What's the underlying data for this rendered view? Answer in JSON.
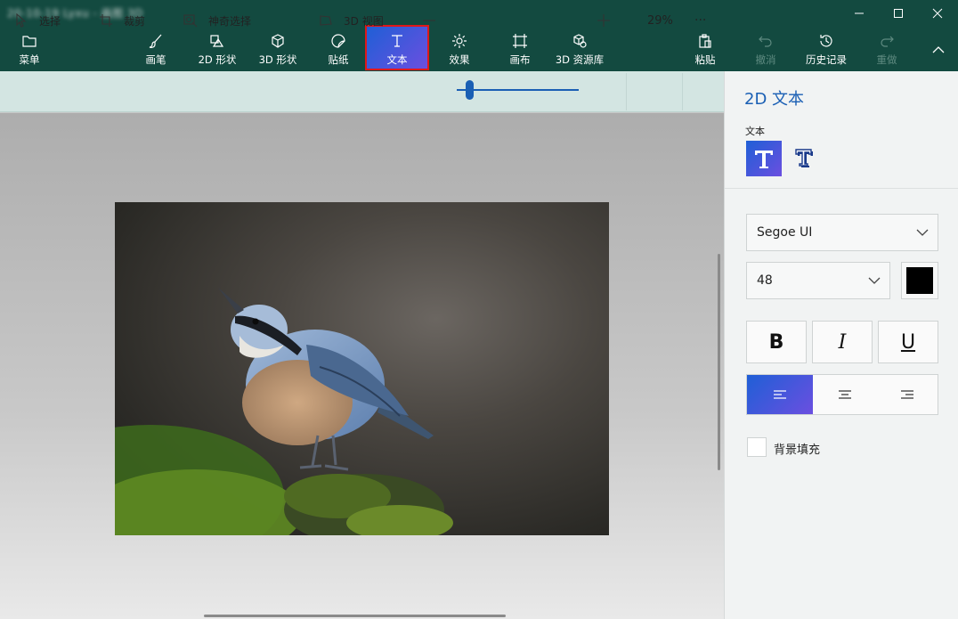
{
  "window": {
    "title_text": "20-10-19 Lyxu - 画图 3D"
  },
  "toolbar": {
    "menu_label": "菜单",
    "brushes_label": "画笔",
    "shapes2d_label": "2D 形状",
    "shapes3d_label": "3D 形状",
    "stickers_label": "贴纸",
    "text_label": "文本",
    "effects_label": "效果",
    "canvas_label": "画布",
    "library3d_label": "3D 资源库",
    "paste_label": "粘贴",
    "undo_label": "撤消",
    "history_label": "历史记录",
    "redo_label": "重做"
  },
  "subtoolbar": {
    "select_label": "选择",
    "crop_label": "裁剪",
    "magic_select_label": "神奇选择",
    "view3d_label": "3D 视图",
    "zoom_percent": "29%",
    "more_label": "···"
  },
  "zoom": {
    "level_fraction": 0.13
  },
  "panel": {
    "title": "2D 文本",
    "text_section_label": "文本",
    "font_family_value": "Segoe UI",
    "font_size_value": "48",
    "bold_label": "B",
    "italic_label": "I",
    "underline_label": "U",
    "text_color": "#000000",
    "fill_background_label": "背景填充"
  },
  "colors": {
    "topbar": "#134a40",
    "accent": "#1a5fb4",
    "active_gradient_start": "#1f5fd6",
    "active_gradient_end": "#6b4fe0",
    "highlight_border": "#e01818"
  }
}
